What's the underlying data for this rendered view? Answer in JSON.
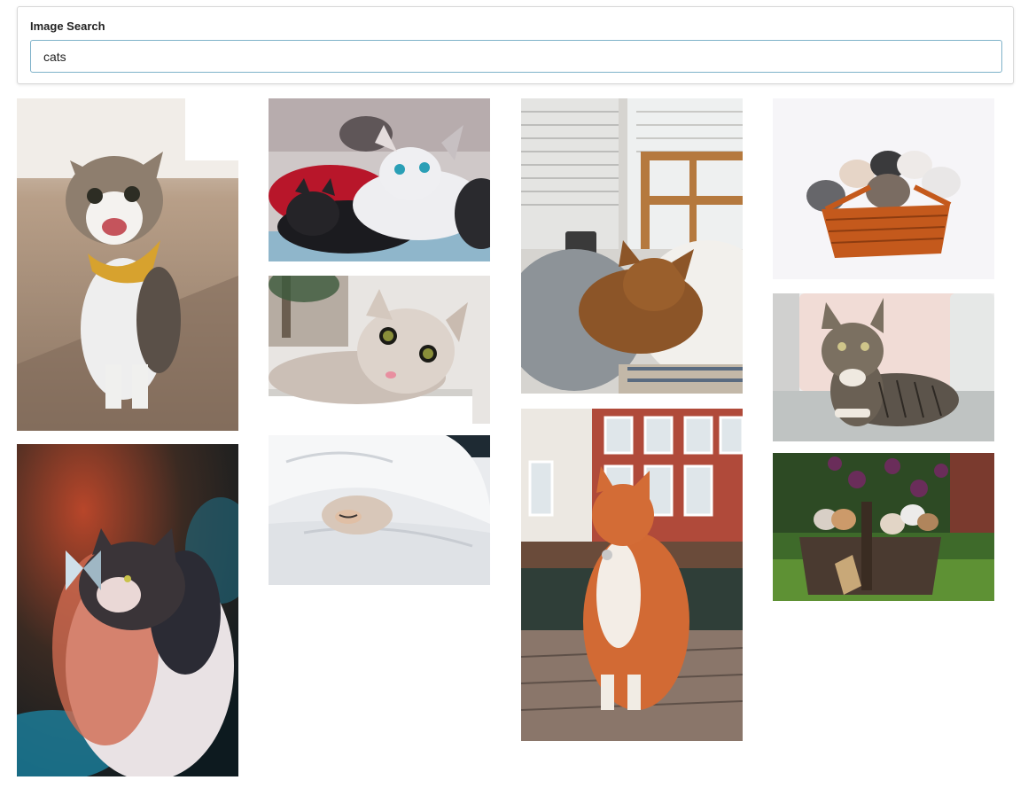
{
  "search": {
    "label": "Image Search",
    "value": "cats"
  },
  "results": [
    {
      "subject": "cat-with-yellow-bandana",
      "icon": "image-icon"
    },
    {
      "subject": "fluffy-cat-with-butterfly",
      "icon": "image-icon"
    },
    {
      "subject": "kittens-on-red-blanket",
      "icon": "image-icon"
    },
    {
      "subject": "surprised-cat",
      "icon": "image-icon"
    },
    {
      "subject": "cat-under-white-blanket",
      "icon": "image-icon"
    },
    {
      "subject": "sleeping-cat-by-window",
      "icon": "image-icon"
    },
    {
      "subject": "orange-cat-on-street",
      "icon": "image-icon"
    },
    {
      "subject": "kittens-in-orange-basket",
      "icon": "image-icon"
    },
    {
      "subject": "tabby-cat-on-sofa",
      "icon": "image-icon"
    },
    {
      "subject": "kittens-in-garden-basket",
      "icon": "image-icon"
    }
  ],
  "colors": {
    "input_border": "#7fb2c9",
    "card_border": "#d8d8d8"
  }
}
